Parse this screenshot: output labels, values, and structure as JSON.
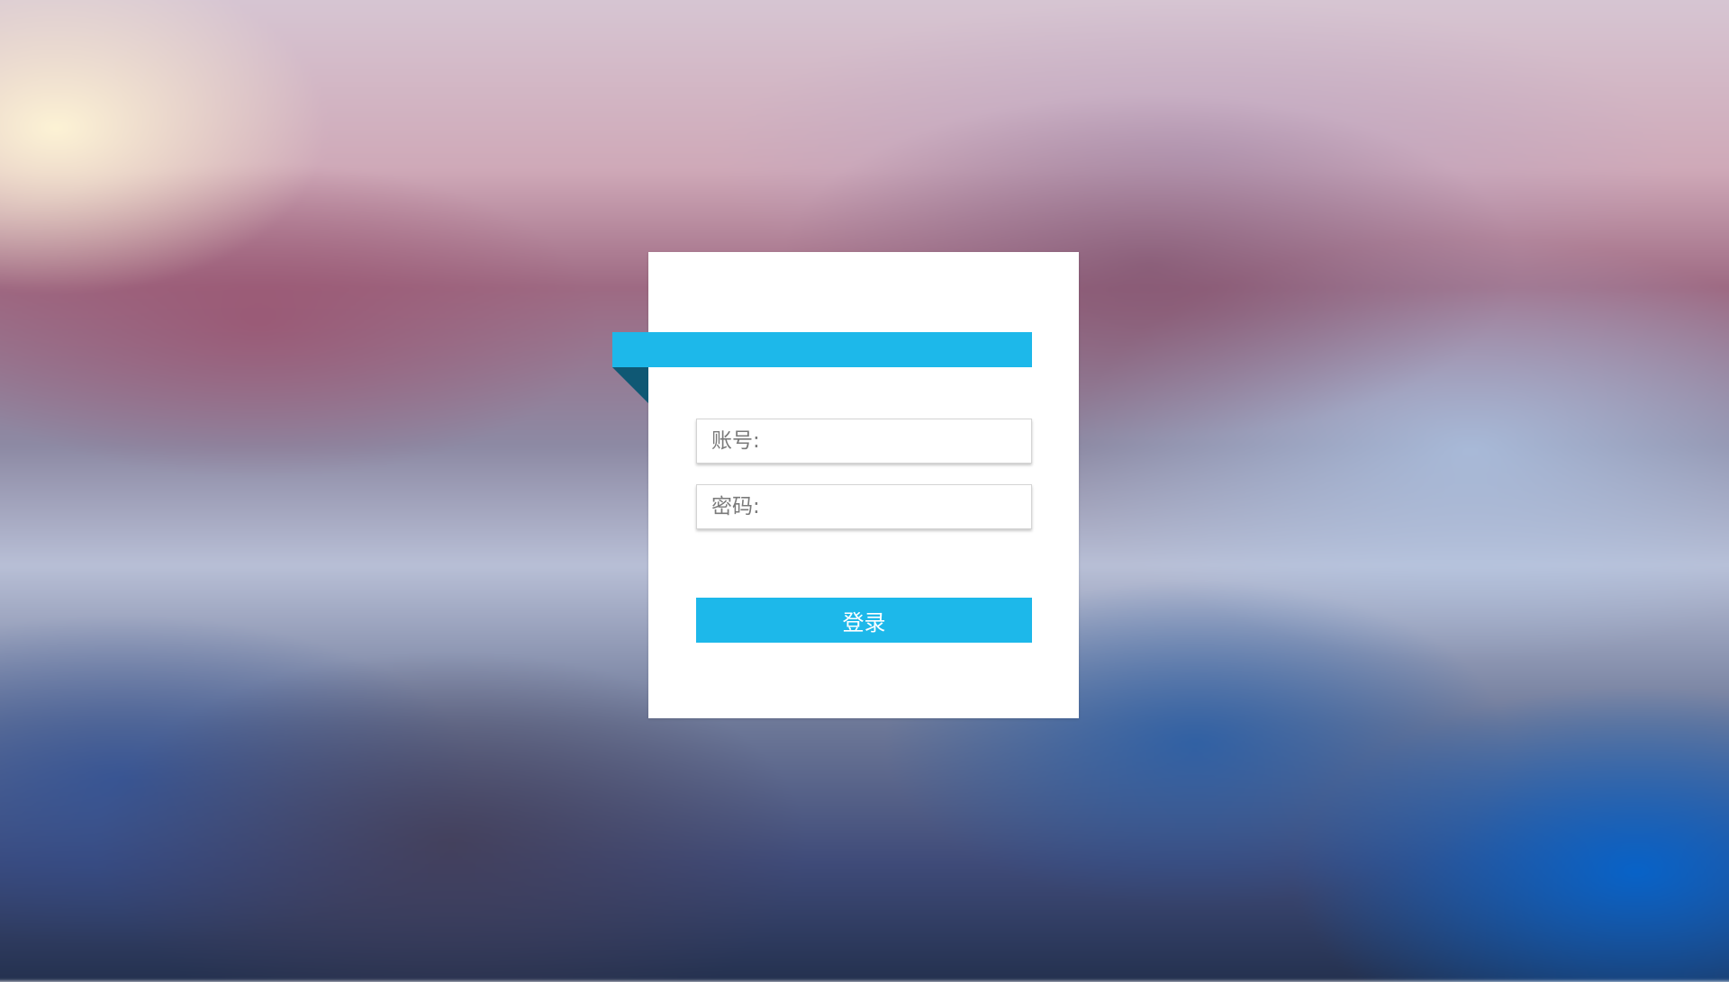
{
  "colors": {
    "accent": "#1db8ea",
    "accent_dark": "#0f5874",
    "card": "#ffffff"
  },
  "login_form": {
    "account_placeholder": "账号:",
    "password_placeholder": "密码:",
    "submit_label": "登录"
  }
}
